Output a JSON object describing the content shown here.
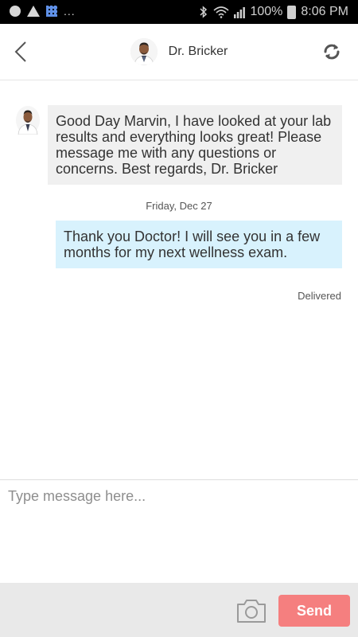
{
  "status_bar": {
    "battery": "100%",
    "time": "8:06 PM",
    "ellipsis": "..."
  },
  "header": {
    "contact_name": "Dr. Bricker"
  },
  "conversation": {
    "incoming_message": "Good Day Marvin, I have looked at your lab results and everything looks great! Please message me with any questions or concerns. Best regards, Dr. Bricker",
    "date_divider": "Friday, Dec 27",
    "outgoing_message": "Thank you Doctor! I will see you in a few months for my next wellness exam.",
    "delivery_status": "Delivered"
  },
  "composer": {
    "value": "",
    "placeholder": "Type message here..."
  },
  "actions": {
    "send_label": "Send"
  },
  "icons": {
    "back": "chevron-left-icon",
    "refresh": "refresh-icon",
    "camera": "camera-icon"
  },
  "colors": {
    "send_button": "#f57f7f",
    "incoming_bubble": "#f0f0f0",
    "outgoing_bubble": "#d8f2fd",
    "bottom_bar": "#e9e9e9"
  }
}
